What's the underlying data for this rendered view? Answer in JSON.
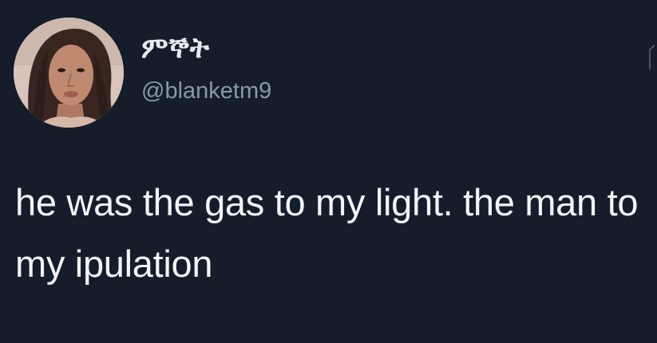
{
  "tweet": {
    "display_name": "ምኞት",
    "handle": "@blanketm9",
    "text": "he was the gas to my light. the man to my ipulation"
  },
  "avatar": {
    "icon": "profile-photo"
  },
  "colors": {
    "background": "#151c2a",
    "name": "#e7ebef",
    "handle": "#8899a6",
    "text": "#f2f4f6"
  }
}
